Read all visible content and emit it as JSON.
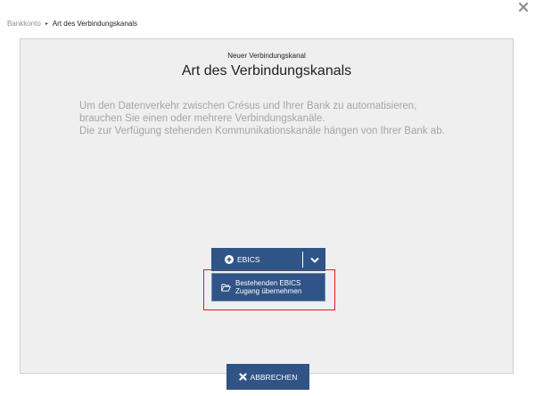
{
  "breadcrumb": {
    "parent": "Bankkonto",
    "separator": "▸",
    "current": "Art des Verbindungskanals"
  },
  "dialog": {
    "subtitle": "Neuer Verbindungskanal",
    "title": "Art des Verbindungskanals",
    "description_lines": [
      "Um den Datenverkehr zwischen Crésus und Ihrer Bank zu automatisieren,",
      "brauchen Sie einen oder mehrere Verbindungskanäle.",
      "Die zur Verfügung stehenden Kommunikationskanäle hängen von Ihrer Bank ab."
    ]
  },
  "actions": {
    "ebics_label": "EBICS",
    "ebics_icon": "plus-circle-icon",
    "toggle_icon": "chevron-down-icon",
    "dropdown_item_lines": [
      "Bestehenden EBICS",
      "Zugang übernehmen"
    ],
    "dropdown_item_icon": "folder-open-icon",
    "cancel_label": "ABBRECHEN",
    "cancel_icon": "close-icon",
    "close_icon": "close-icon"
  },
  "colors": {
    "button": "#2f5485",
    "panel": "#efefef",
    "highlight": "#e0191b",
    "muted_text": "#a2a5a9"
  }
}
